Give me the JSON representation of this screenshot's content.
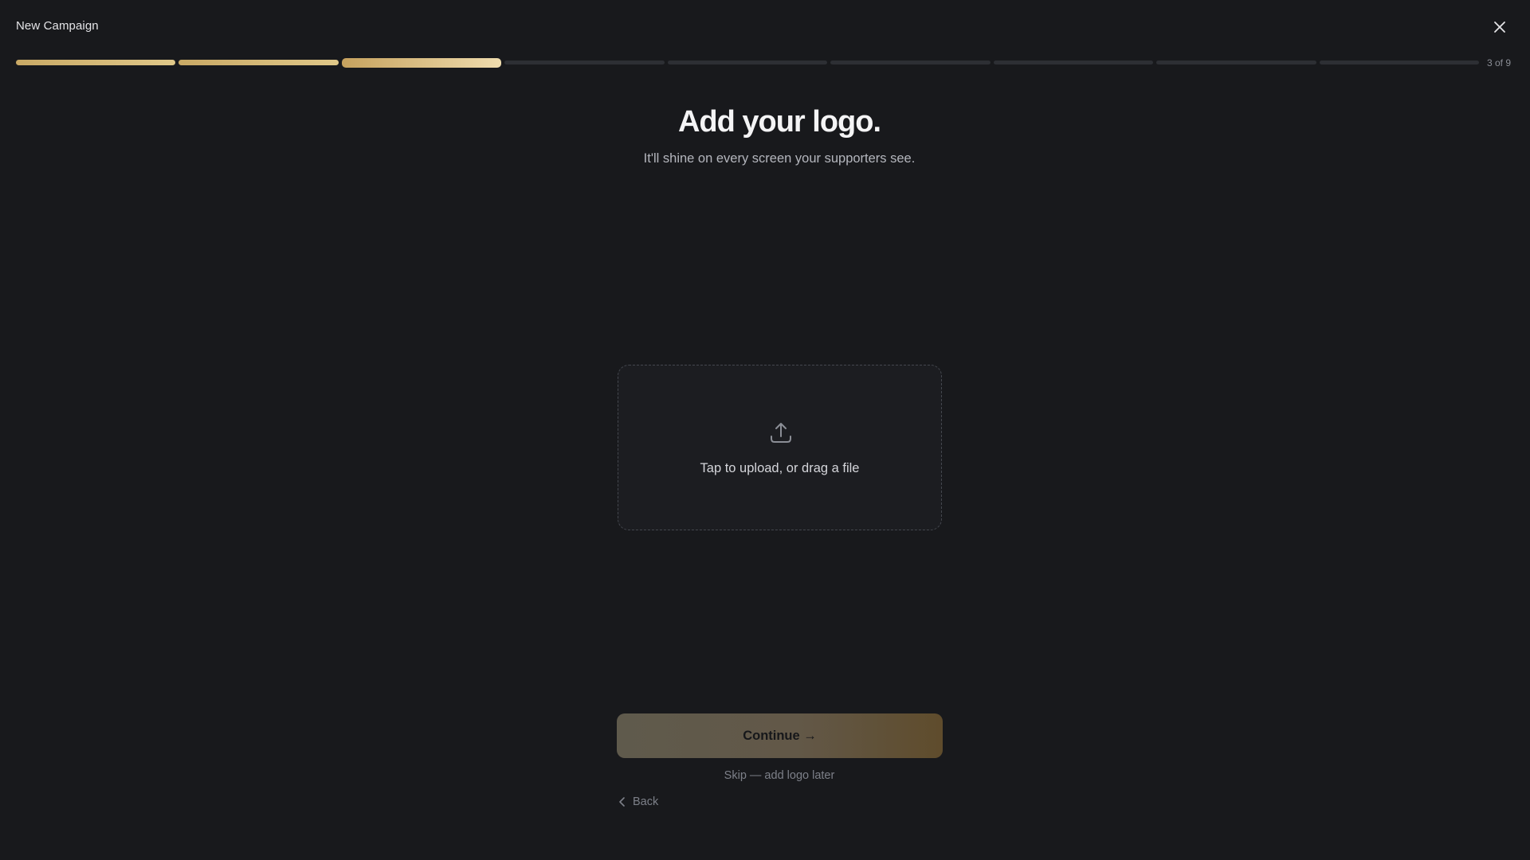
{
  "header": {
    "title": "New Campaign",
    "close_icon": "close-icon"
  },
  "progress": {
    "current_step": 3,
    "total_steps": 9,
    "label": "3 of 9"
  },
  "main": {
    "heading": "Add your logo.",
    "subheading": "It'll shine on every screen your supporters see."
  },
  "upload": {
    "icon": "upload-icon",
    "label": "Tap to upload, or drag a file"
  },
  "actions": {
    "continue_label": "Continue →",
    "skip_label": "Skip — add logo later",
    "back_label": "Back",
    "back_icon": "chevron-left-icon"
  },
  "colors": {
    "background": "#18191c",
    "accent_gold": "#d9bd7e",
    "track": "#2d2f34"
  }
}
